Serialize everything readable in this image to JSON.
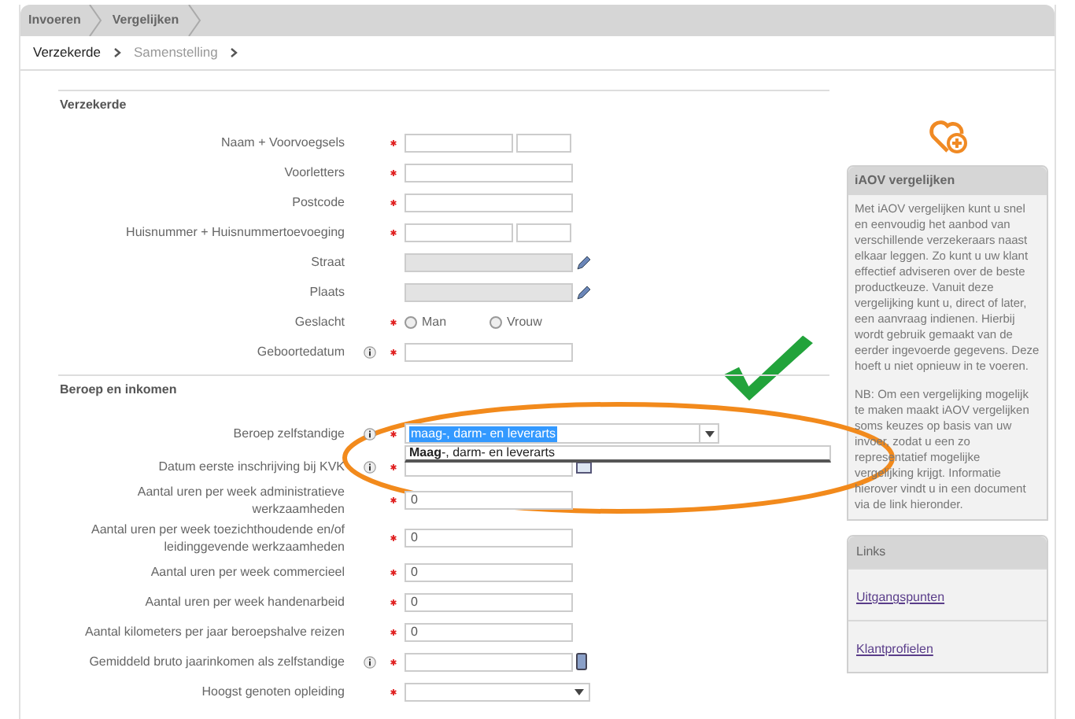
{
  "steps": [
    {
      "label": "Invoeren"
    },
    {
      "label": "Vergelijken"
    }
  ],
  "substeps": [
    {
      "label": "Verzekerde",
      "selected": true
    },
    {
      "label": "Samenstelling",
      "selected": false
    }
  ],
  "sections": [
    {
      "title": "Verzekerde",
      "fields": [
        {
          "label": "Naam + Voorvoegsels",
          "kind": "split",
          "required": true,
          "info": false
        },
        {
          "label": "Voorletters",
          "kind": "text",
          "required": true,
          "info": false
        },
        {
          "label": "Postcode",
          "kind": "text",
          "required": true,
          "info": false
        },
        {
          "label": "Huisnummer + Huisnummertoevoeging",
          "kind": "split",
          "required": true,
          "info": false
        },
        {
          "label": "Straat",
          "kind": "readonly",
          "required": false,
          "info": false
        },
        {
          "label": "Plaats",
          "kind": "readonly",
          "required": false,
          "info": false
        },
        {
          "label": "Geslacht",
          "kind": "radio",
          "required": true,
          "info": false,
          "options": [
            {
              "label": "Man",
              "selected": false
            },
            {
              "label": "Vrouw",
              "selected": false
            }
          ]
        },
        {
          "label": "Geboortedatum",
          "kind": "text",
          "required": true,
          "info": true
        }
      ]
    },
    {
      "title": "Beroep en inkomen",
      "fields": [
        {
          "label": "Beroep zelfstandige",
          "kind": "combo",
          "required": true,
          "info": true,
          "value": "maag-, darm- en leverarts",
          "suggestion": "**Maag**-, darm- en leverarts"
        },
        {
          "label": "Datum eerste inschrijving bij KVK",
          "kind": "date",
          "required": true,
          "info": true
        },
        {
          "label": "Aantal uren per week administratieve werkzaamheden",
          "kind": "text",
          "required": true,
          "info": false,
          "value": "0"
        },
        {
          "label": "Aantal uren per week toezichthoudende en/of leidinggevende werkzaamheden",
          "kind": "text",
          "required": true,
          "info": false,
          "value": "0"
        },
        {
          "label": "Aantal uren per week commercieel",
          "kind": "text",
          "required": true,
          "info": false,
          "value": "0"
        },
        {
          "label": "Aantal uren per week handenarbeid",
          "kind": "text",
          "required": true,
          "info": false,
          "value": "0"
        },
        {
          "label": "Aantal kilometers per jaar beroepshalve reizen",
          "kind": "text",
          "required": true,
          "info": false,
          "value": "0"
        },
        {
          "label": "Gemiddeld bruto jaarinkomen als zelfstandige",
          "kind": "calc",
          "required": true,
          "info": true
        },
        {
          "label": "Hoogst genoten opleiding",
          "kind": "select",
          "required": true,
          "info": false
        }
      ]
    }
  ],
  "info_box": {
    "title": "iAOV vergelijken",
    "paragraphs": [
      "Met iAOV vergelijken kunt u snel en eenvoudig het aanbod van verschillende verzekeraars naast elkaar leggen. Zo kunt u uw klant effectief adviseren over de beste productkeuze. Vanuit deze vergelijking kunt u, direct of later, een aanvraag indienen. Hierbij wordt gebruik gemaakt van de eerder ingevoerde gegevens. Deze hoeft u niet opnieuw in te voeren.",
      "NB: Om een vergelijking mogelijk te maken maakt iAOV vergelijken soms keuzes op basis van uw invoer, zodat u een zo representatief mogelijke vergelijking krijgt. Informatie hierover vindt u in een document via de link hieronder."
    ]
  },
  "links_box": {
    "title": "Links",
    "links": [
      "Uitgangspunten",
      "Klantprofielen"
    ]
  }
}
